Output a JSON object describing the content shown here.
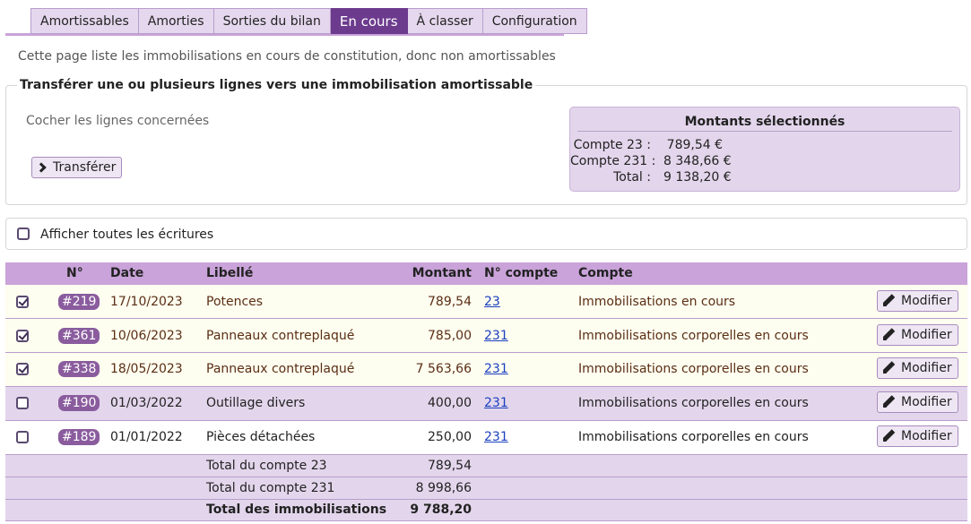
{
  "tabs": [
    {
      "label": "Amortissables"
    },
    {
      "label": "Amorties"
    },
    {
      "label": "Sorties du bilan"
    },
    {
      "label": "En cours"
    },
    {
      "label": "À classer"
    },
    {
      "label": "Configuration"
    }
  ],
  "active_tab": "En cours",
  "intro": "Cette page liste les immobilisations en cours de constitution, donc non amortissables",
  "transfer": {
    "legend": "Transférer une ou plusieurs lignes vers une immobilisation amortissable",
    "help": "Cocher les lignes concernées",
    "button": "Transférer"
  },
  "summary": {
    "title": "Montants sélectionnés",
    "rows": [
      {
        "label": "Compte 23 :",
        "value": "789,54 €"
      },
      {
        "label": "Compte 231 :",
        "value": "8 348,66 €"
      },
      {
        "label": "Total :",
        "value": "9 138,20 €"
      }
    ]
  },
  "toggle": {
    "label": "Afficher toutes les écritures",
    "checked": false
  },
  "table": {
    "headers": {
      "num": "N°",
      "date": "Date",
      "libelle": "Libellé",
      "montant": "Montant",
      "ncompte": "N° compte",
      "compte": "Compte"
    },
    "rows": [
      {
        "checked": true,
        "num": "#219",
        "date": "17/10/2023",
        "libelle": "Potences",
        "montant": "789,54",
        "ncompte": "23",
        "compte": "Immobilisations en cours",
        "action": "Modifier"
      },
      {
        "checked": true,
        "num": "#361",
        "date": "10/06/2023",
        "libelle": "Panneaux contreplaqué",
        "montant": "785,00",
        "ncompte": "231",
        "compte": "Immobilisations corporelles en cours",
        "action": "Modifier"
      },
      {
        "checked": true,
        "num": "#338",
        "date": "18/05/2023",
        "libelle": "Panneaux contreplaqué",
        "montant": "7 563,66",
        "ncompte": "231",
        "compte": "Immobilisations corporelles en cours",
        "action": "Modifier"
      },
      {
        "checked": false,
        "num": "#190",
        "date": "01/03/2022",
        "libelle": "Outillage divers",
        "montant": "400,00",
        "ncompte": "231",
        "compte": "Immobilisations corporelles en cours",
        "action": "Modifier"
      },
      {
        "checked": false,
        "num": "#189",
        "date": "01/01/2022",
        "libelle": "Pièces détachées",
        "montant": "250,00",
        "ncompte": "231",
        "compte": "Immobilisations corporelles en cours",
        "action": "Modifier"
      }
    ],
    "totals": [
      {
        "label": "Total du compte 23",
        "value": "789,54"
      },
      {
        "label": "Total du compte 231",
        "value": "8 998,66"
      },
      {
        "label": "Total des immobilisations",
        "value": "9 788,20"
      }
    ]
  },
  "colors": {
    "accent": "#6c3b8e",
    "header": "#c9a3d9",
    "alt_row": "#e3d6ec",
    "selected_row": "#fdfdf0",
    "link": "#1a3fbf"
  }
}
